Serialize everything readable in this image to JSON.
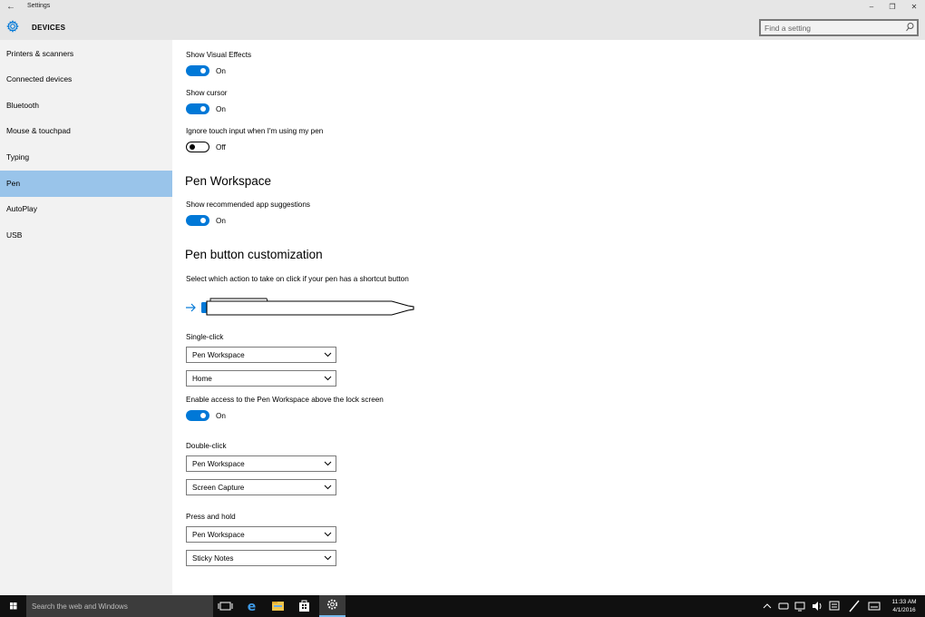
{
  "window": {
    "title": "Settings"
  },
  "header": {
    "section_title": "DEVICES",
    "search_placeholder": "Find a setting"
  },
  "sidebar": {
    "items": [
      {
        "label": "Printers & scanners"
      },
      {
        "label": "Connected devices"
      },
      {
        "label": "Bluetooth"
      },
      {
        "label": "Mouse & touchpad"
      },
      {
        "label": "Typing"
      },
      {
        "label": "Pen",
        "selected": true
      },
      {
        "label": "AutoPlay"
      },
      {
        "label": "USB"
      }
    ]
  },
  "main": {
    "show_visual_effects": {
      "label": "Show Visual Effects",
      "state": "On"
    },
    "show_cursor": {
      "label": "Show cursor",
      "state": "On"
    },
    "ignore_touch": {
      "label": "Ignore touch input when I'm using my pen",
      "state": "Off"
    },
    "pen_workspace_heading": "Pen Workspace",
    "recommended_apps": {
      "label": "Show recommended app suggestions",
      "state": "On"
    },
    "pen_button_heading": "Pen button customization",
    "pen_button_description": "Select which action to take on click if your pen has a shortcut button",
    "single_click": {
      "label": "Single-click",
      "action": "Pen Workspace",
      "app": "Home"
    },
    "lock_screen": {
      "label": "Enable access to the Pen Workspace above the lock screen",
      "state": "On"
    },
    "double_click": {
      "label": "Double-click",
      "action": "Pen Workspace",
      "app": "Screen Capture"
    },
    "press_hold": {
      "label": "Press and hold",
      "action": "Pen Workspace",
      "app": "Sticky Notes"
    }
  },
  "taskbar": {
    "search_placeholder": "Search the web and Windows",
    "time": "11:33 AM",
    "date": "4/1/2016"
  },
  "colors": {
    "accent": "#0078d7",
    "selected_nav": "#99c4ea",
    "sidebar_bg": "#f2f2f2",
    "header_bg": "#e6e6e6",
    "taskbar_bg": "#101010"
  }
}
